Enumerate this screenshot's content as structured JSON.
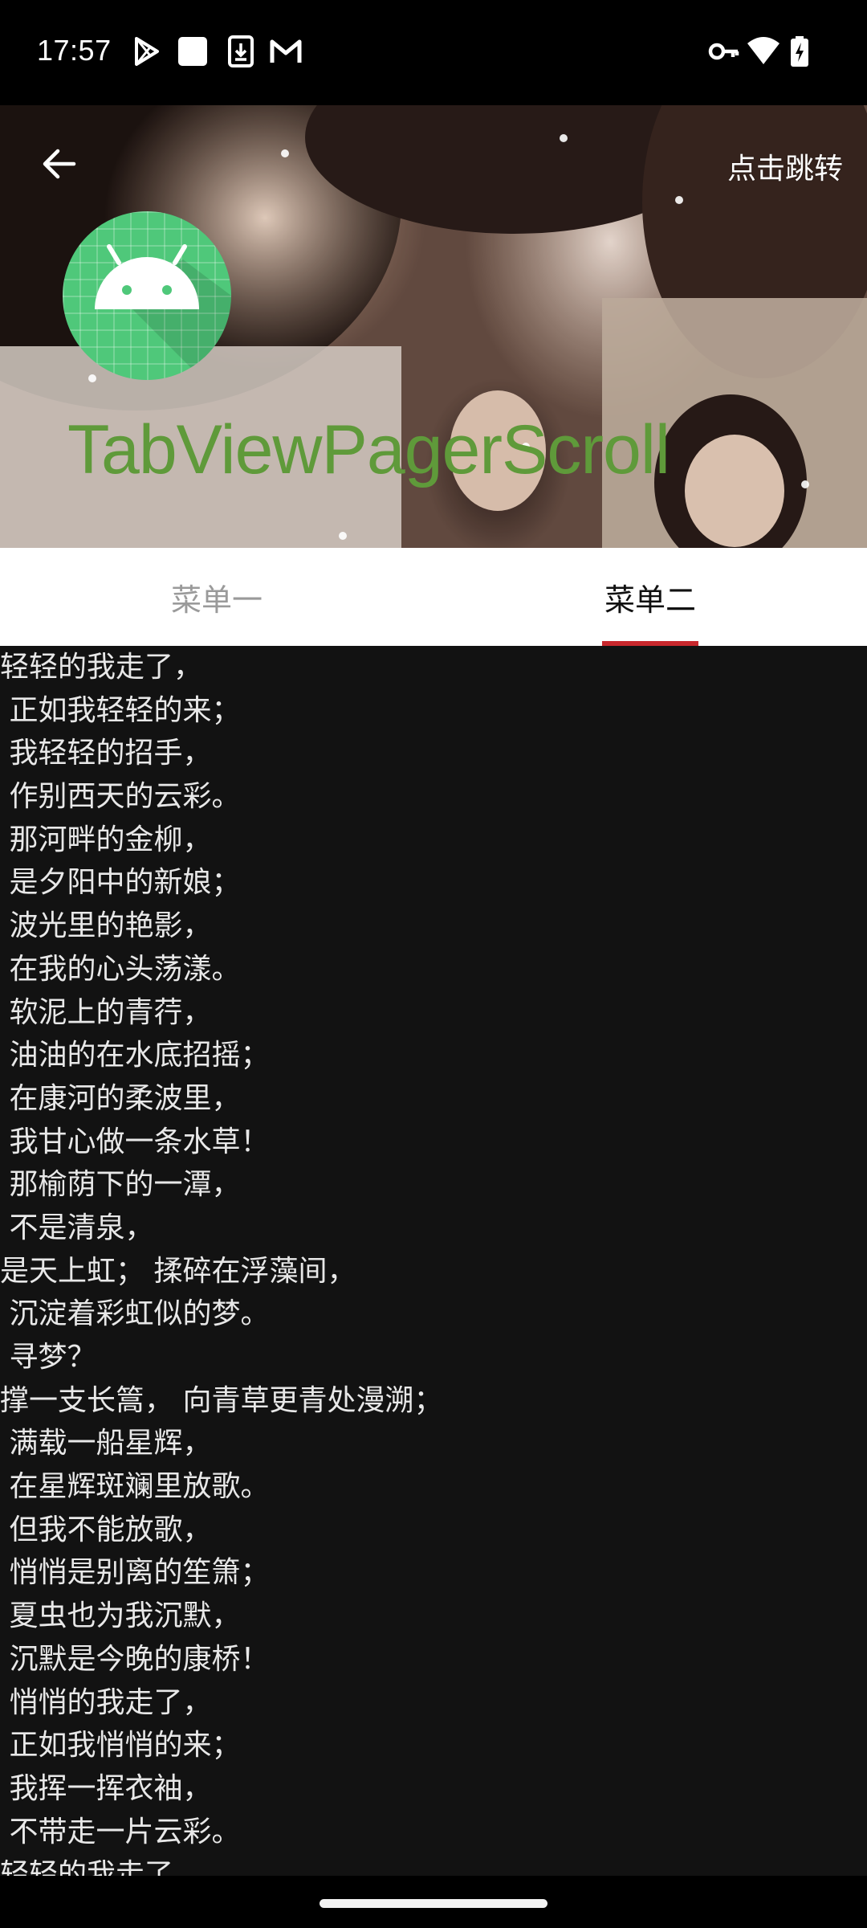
{
  "status_bar": {
    "time": "17:57"
  },
  "header": {
    "back_label": "",
    "jump_label": "点击跳转",
    "title": "TabViewPagerScroll"
  },
  "tabs": [
    {
      "label": "菜单一",
      "active": false
    },
    {
      "label": "菜单二",
      "active": true
    }
  ],
  "poem": {
    "lines": [
      "轻轻的我走了，",
      " 正如我轻轻的来；",
      " 我轻轻的招手，",
      " 作别西天的云彩。",
      " 那河畔的金柳，",
      " 是夕阳中的新娘；",
      " 波光里的艳影，",
      " 在我的心头荡漾。",
      " 软泥上的青荇，",
      " 油油的在水底招摇；",
      " 在康河的柔波里，",
      " 我甘心做一条水草！",
      " 那榆荫下的一潭，",
      " 不是清泉，",
      "是天上虹； 揉碎在浮藻间，",
      " 沉淀着彩虹似的梦。",
      " 寻梦？",
      "撑一支长篙， 向青草更青处漫溯；",
      " 满载一船星辉，",
      " 在星辉斑斓里放歌。",
      " 但我不能放歌，",
      " 悄悄是别离的笙箫；",
      " 夏虫也为我沉默，",
      " 沉默是今晚的康桥！",
      " 悄悄的我走了，",
      " 正如我悄悄的来；",
      " 我挥一挥衣袖，",
      " 不带走一片云彩。",
      "轻轻的我走了，"
    ]
  },
  "colors": {
    "tab_indicator": "#c8282d",
    "title_green": "#5f9a3a",
    "logo_green": "#4fc87a",
    "content_bg": "#121212"
  },
  "icons": {
    "back": "arrow-left-icon",
    "play_store": "play-store-icon",
    "notification": "square-icon",
    "download": "download-icon",
    "gmail": "gmail-icon",
    "vpn_key": "key-icon",
    "wifi": "wifi-icon",
    "battery": "battery-charging-icon",
    "android": "android-icon"
  }
}
